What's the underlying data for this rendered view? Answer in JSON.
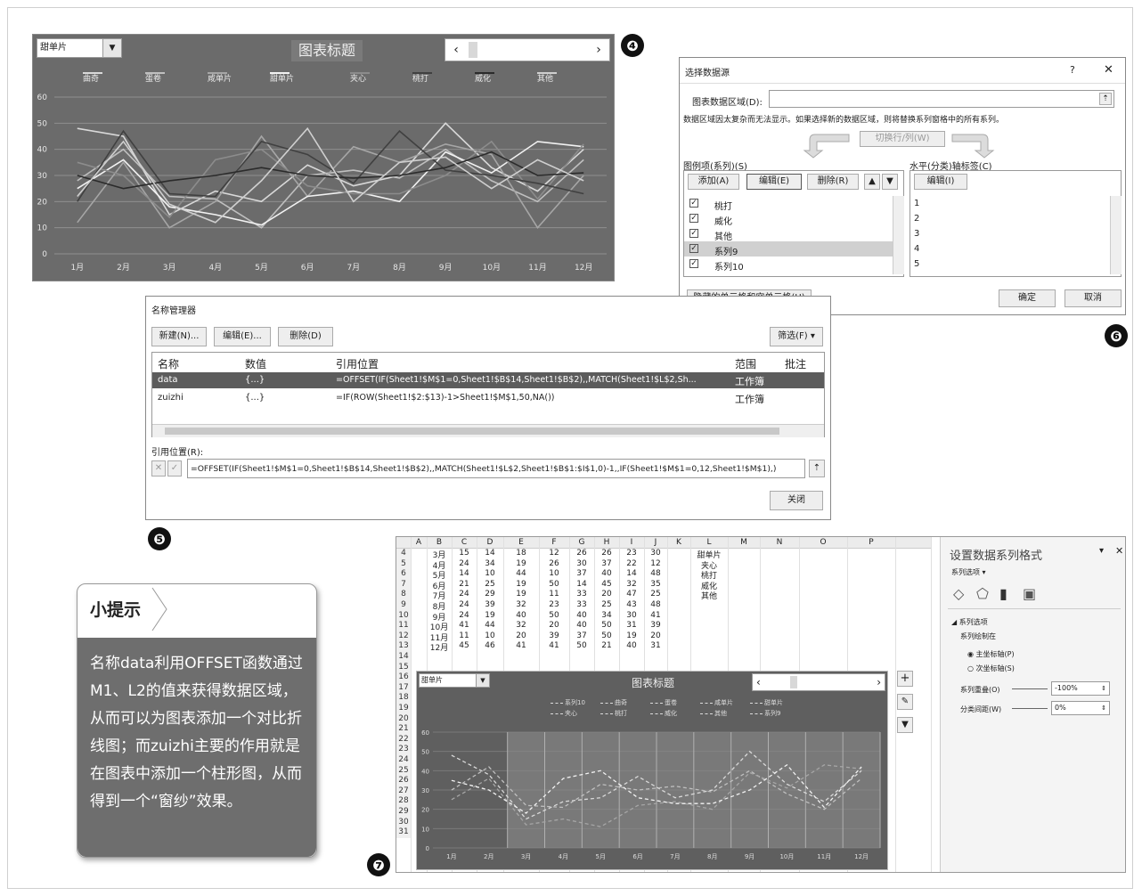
{
  "badges": [
    "❹",
    "❺",
    "❻",
    "❼"
  ],
  "fig4": {
    "dropdown": "甜单片",
    "title": "图表标题",
    "legend": [
      "曲奇",
      "蛋卷",
      "咸单片",
      "甜单片",
      "夹心",
      "桃打",
      "威化",
      "其他"
    ],
    "chart_data": {
      "type": "line",
      "categories": [
        "1月",
        "2月",
        "3月",
        "4月",
        "5月",
        "6月",
        "7月",
        "8月",
        "9月",
        "10月",
        "11月",
        "12月"
      ],
      "ylim": [
        0,
        60
      ],
      "yticks": [
        "0",
        "10",
        "20",
        "30",
        "40",
        "50",
        "60"
      ],
      "series": [
        {
          "name": "曲奇",
          "values": [
            48,
            45,
            15,
            24,
            20,
            34,
            26,
            30,
            50,
            33,
            24,
            40
          ]
        },
        {
          "name": "蛋卷",
          "values": [
            28,
            40,
            22,
            21,
            10,
            30,
            32,
            29,
            40,
            28,
            20,
            36
          ]
        },
        {
          "name": "咸单片",
          "values": [
            12,
            35,
            10,
            20,
            45,
            22,
            41,
            35,
            42,
            38,
            10,
            30
          ]
        },
        {
          "name": "甜单片",
          "values": [
            25,
            36,
            18,
            15,
            11,
            22,
            24,
            20,
            39,
            31,
            43,
            41
          ]
        },
        {
          "name": "夹心",
          "values": [
            35,
            30,
            14,
            36,
            40,
            26,
            23,
            23,
            30,
            43,
            21,
            42
          ]
        },
        {
          "name": "桃打",
          "values": [
            20,
            47,
            23,
            22,
            43,
            38,
            27,
            47,
            32,
            30,
            27,
            23
          ]
        },
        {
          "name": "威化",
          "values": [
            30,
            25,
            28,
            30,
            33,
            30,
            29,
            30,
            33,
            39,
            30,
            31
          ]
        },
        {
          "name": "其他",
          "values": [
            22,
            43,
            19,
            12,
            28,
            48,
            20,
            35,
            37,
            25,
            36,
            28
          ]
        }
      ]
    }
  },
  "fig6": {
    "title": "选择数据源",
    "help": "?",
    "close": "✕",
    "range_label": "图表数据区域(D):",
    "notice": "数据区域因太复杂而无法显示。如果选择新的数据区域，则将替换系列窗格中的所有系列。",
    "switch_btn": "切换行/列(W)",
    "legend_label": "图例项(系列)(S)",
    "axis_label": "水平(分类)轴标签(C)",
    "add_btn": "添加(A)",
    "edit_btn": "编辑(E)",
    "delete_btn": "删除(R)",
    "axis_edit_btn": "编辑(I)",
    "series": [
      "桃打",
      "威化",
      "其他",
      "系列9",
      "系列10"
    ],
    "axis_items": [
      "1",
      "2",
      "3",
      "4",
      "5"
    ],
    "hidden_btn": "隐藏的单元格和空单元格(H)",
    "ok": "确定",
    "cancel": "取消"
  },
  "fig5": {
    "title": "名称管理器",
    "new_btn": "新建(N)...",
    "edit_btn": "编辑(E)...",
    "delete_btn": "删除(D)",
    "filter_btn": "筛选(F) ▾",
    "headers": [
      "名称",
      "数值",
      "引用位置",
      "范围",
      "批注"
    ],
    "rows": [
      {
        "name": "data",
        "value": "{...}",
        "ref": "=OFFSET(IF(Sheet1!$M$1=0,Sheet1!$B$14,Sheet1!$B$2),,MATCH(Sheet1!$L$2,Sh...",
        "scope": "工作簿"
      },
      {
        "name": "zuizhi",
        "value": "{...}",
        "ref": "=IF(ROW(Sheet1!$2:$13)-1>Sheet1!$M$1,50,NA())",
        "scope": "工作簿"
      }
    ],
    "ref_label": "引用位置(R):",
    "ref_value": "=OFFSET(IF(Sheet1!$M$1=0,Sheet1!$B$14,Sheet1!$B$2),,MATCH(Sheet1!$L$2,Sheet1!$B$1:$I$1,0)-1,,IF(Sheet1!$M$1=0,12,Sheet1!$M$1),)",
    "close_btn": "关闭"
  },
  "tip": {
    "title": "小提示",
    "body": "名称data利用OFFSET函数通过M1、L2的值来获得数据区域，从而可以为图表添加一个对比折线图；而zuizhi主要的作用就是在图表中添加一个柱形图，从而得到一个“窗纱”效果。"
  },
  "fig7": {
    "columns": [
      "A",
      "B",
      "C",
      "D",
      "E",
      "F",
      "G",
      "H",
      "I",
      "J",
      "K",
      "L",
      "M",
      "N",
      "O",
      "P"
    ],
    "rows": [
      {
        "n": "4",
        "v": [
          "3月",
          "15",
          "14",
          "18",
          "12",
          "26",
          "26",
          "23",
          "30"
        ],
        "k": "甜单片"
      },
      {
        "n": "5",
        "v": [
          "4月",
          "24",
          "34",
          "19",
          "26",
          "30",
          "37",
          "22",
          "12"
        ],
        "k": "夹心"
      },
      {
        "n": "6",
        "v": [
          "5月",
          "14",
          "10",
          "44",
          "10",
          "37",
          "40",
          "14",
          "48"
        ],
        "k": "桃打"
      },
      {
        "n": "7",
        "v": [
          "6月",
          "21",
          "25",
          "19",
          "50",
          "14",
          "45",
          "32",
          "35"
        ],
        "k": "威化"
      },
      {
        "n": "8",
        "v": [
          "7月",
          "24",
          "29",
          "19",
          "11",
          "33",
          "20",
          "47",
          "25"
        ],
        "k": "其他"
      },
      {
        "n": "9",
        "v": [
          "8月",
          "24",
          "39",
          "32",
          "23",
          "33",
          "25",
          "43",
          "48"
        ],
        "k": ""
      },
      {
        "n": "10",
        "v": [
          "9月",
          "24",
          "19",
          "40",
          "50",
          "40",
          "34",
          "30",
          "41"
        ],
        "k": ""
      },
      {
        "n": "11",
        "v": [
          "10月",
          "41",
          "44",
          "32",
          "20",
          "40",
          "50",
          "31",
          "39"
        ],
        "k": ""
      },
      {
        "n": "12",
        "v": [
          "11月",
          "11",
          "10",
          "20",
          "39",
          "37",
          "50",
          "19",
          "20"
        ],
        "k": ""
      },
      {
        "n": "13",
        "v": [
          "12月",
          "45",
          "46",
          "41",
          "41",
          "50",
          "21",
          "40",
          "31"
        ],
        "k": ""
      }
    ],
    "more_rows": [
      "14",
      "15",
      "16",
      "17",
      "18",
      "19",
      "20",
      "21",
      "22",
      "23",
      "24",
      "25",
      "26",
      "27",
      "28",
      "29",
      "30",
      "31"
    ],
    "chart_dropdown": "甜单片",
    "chart_title": "图表标题",
    "legend": [
      "系列10",
      "曲奇",
      "蛋卷",
      "咸单片",
      "甜单片",
      "夹心",
      "桃打",
      "威化",
      "其他",
      "系列9"
    ],
    "chart_data": {
      "type": "line",
      "categories": [
        "1月",
        "2月",
        "3月",
        "4月",
        "5月",
        "6月",
        "7月",
        "8月",
        "9月",
        "10月",
        "11月",
        "12月"
      ],
      "ylim": [
        0,
        60
      ],
      "yticks": [
        "0",
        "10",
        "20",
        "30",
        "40",
        "50",
        "60"
      ],
      "highlight_start": "3月",
      "series": [
        {
          "name": "曲奇",
          "values": [
            48,
            38,
            15,
            24,
            26,
            37,
            26,
            30,
            50,
            33,
            24,
            40
          ]
        },
        {
          "name": "蛋卷",
          "values": [
            30,
            42,
            22,
            21,
            33,
            30,
            32,
            29,
            40,
            28,
            20,
            36
          ]
        },
        {
          "name": "甜单片",
          "values": [
            25,
            36,
            12,
            15,
            11,
            22,
            24,
            20,
            39,
            31,
            43,
            41
          ]
        },
        {
          "name": "夹心",
          "values": [
            35,
            30,
            18,
            36,
            40,
            26,
            23,
            23,
            30,
            43,
            21,
            42
          ]
        }
      ]
    },
    "pane": {
      "title": "设置数据系列格式",
      "sub": "系列选项 ▾",
      "section": "◢ 系列选项",
      "plot_on": "系列绘制在",
      "primary": "主坐标轴(P)",
      "secondary": "次坐标轴(S)",
      "overlap_label": "系列重叠(O)",
      "overlap_value": "-100%",
      "gap_label": "分类间距(W)",
      "gap_value": "0%"
    }
  }
}
